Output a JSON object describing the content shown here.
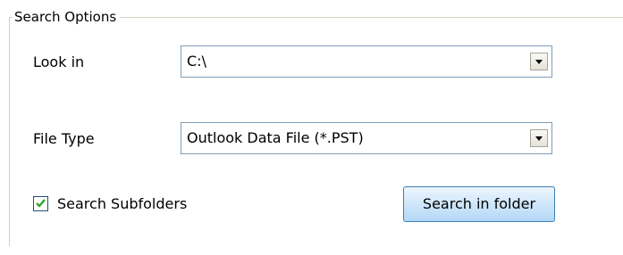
{
  "group": {
    "title": "Search Options"
  },
  "look_in": {
    "label": "Look in",
    "value": "C:\\"
  },
  "file_type": {
    "label": "File Type",
    "value": "Outlook Data File (*.PST)"
  },
  "subfolders": {
    "label": "Search Subfolders",
    "checked": true
  },
  "search_button": {
    "label": "Search in folder"
  }
}
